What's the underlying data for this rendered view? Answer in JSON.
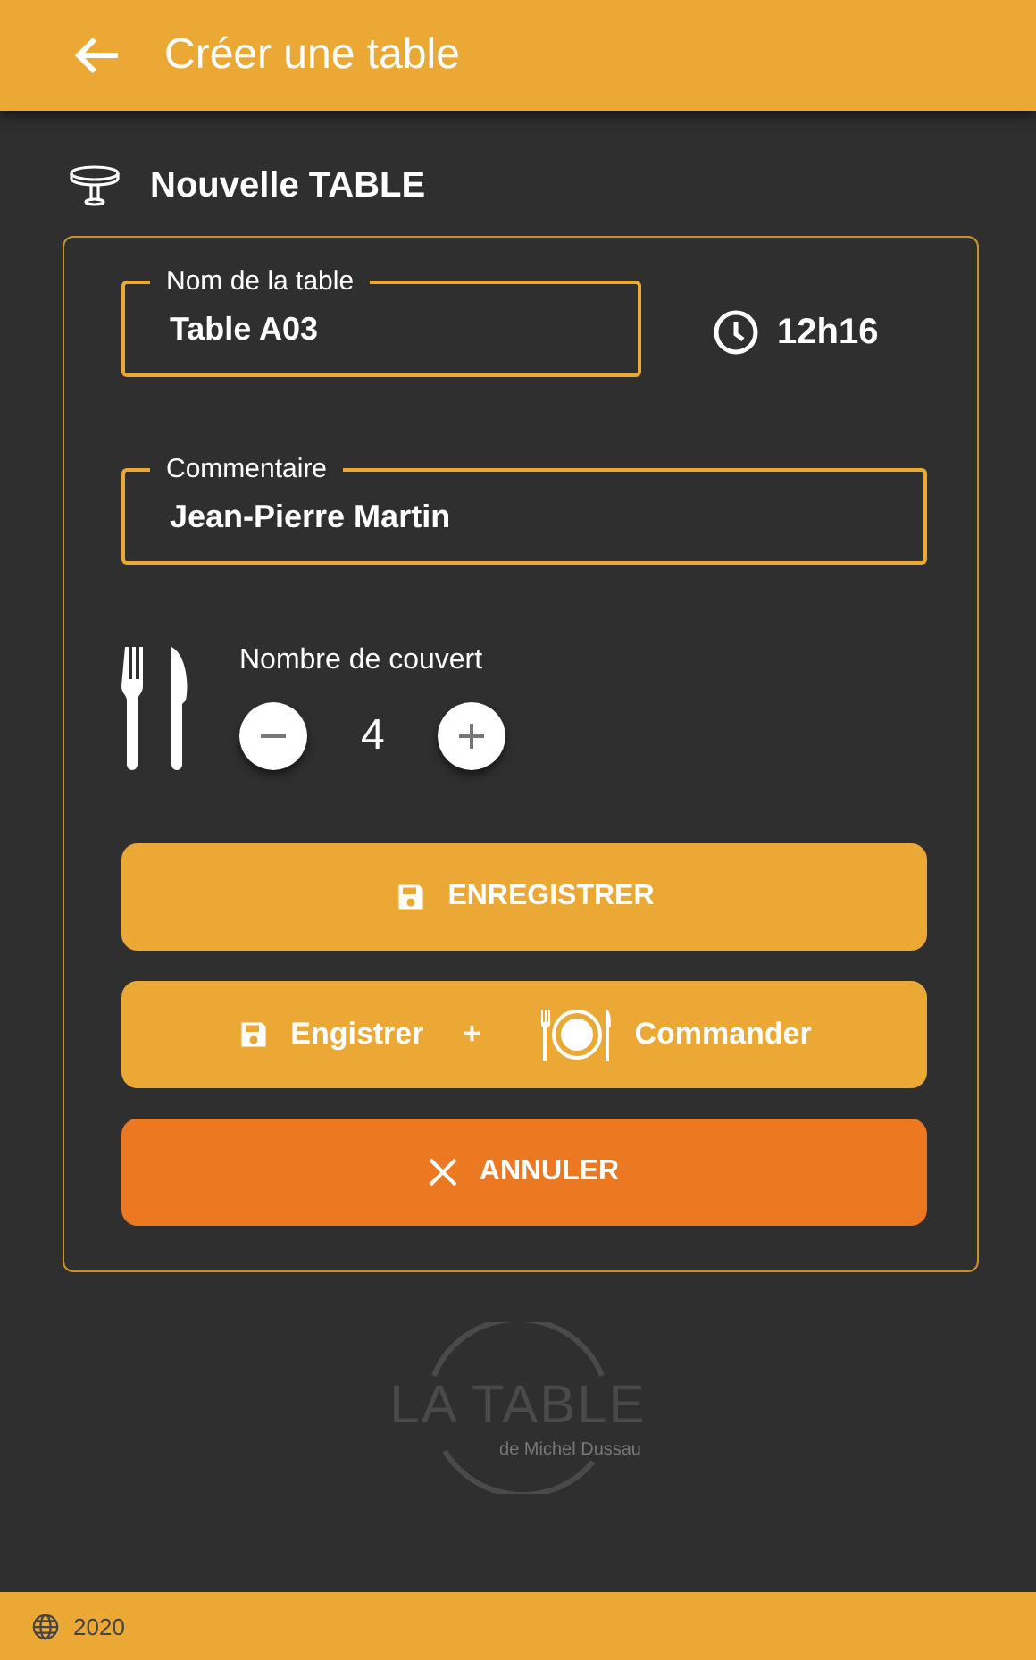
{
  "app_bar": {
    "title": "Créer une table"
  },
  "section": {
    "title": "Nouvelle TABLE"
  },
  "form": {
    "name_field": {
      "label": "Nom de la table",
      "value": "Table A03"
    },
    "time": "12h16",
    "comment_field": {
      "label": "Commentaire",
      "value": "Jean-Pierre Martin"
    },
    "covers": {
      "label": "Nombre de couvert",
      "value": "4"
    },
    "buttons": [
      {
        "kind": "save",
        "label": "ENREGISTRER"
      },
      {
        "kind": "save_order",
        "label": "Engistrer",
        "joiner": "+",
        "label_2": "Commander"
      },
      {
        "kind": "cancel",
        "label": "ANNULER"
      }
    ]
  },
  "logo": {
    "title": "LA TABLE",
    "subtitle": "de Michel Dussau"
  },
  "footer": {
    "year": "2020"
  }
}
